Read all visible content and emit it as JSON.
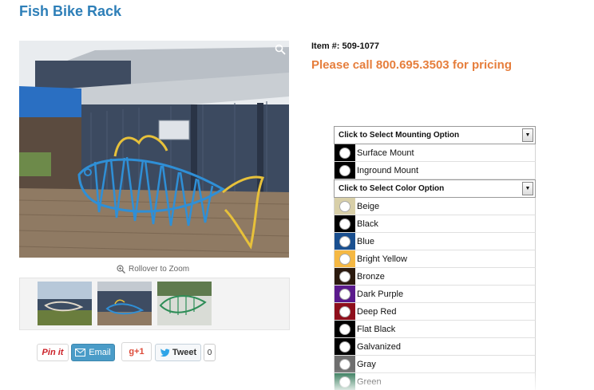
{
  "product": {
    "title": "Fish Bike Rack",
    "item_number": "Item #: 509-1077",
    "pricing_text": "Please call 800.695.3503 for pricing"
  },
  "gallery": {
    "zoom_label": "Rollover to Zoom",
    "zoom_icon": "magnifier-icon",
    "thumbnails": [
      "thumbnail-1",
      "thumbnail-2",
      "thumbnail-3"
    ]
  },
  "share": {
    "pinit_label": "Pin it",
    "email_label": "Email",
    "gplus_label": "g+1",
    "tweet_label": "Tweet",
    "tweet_count": "0"
  },
  "mounting": {
    "select_label": "Click to Select Mounting Option",
    "options": [
      {
        "label": "Surface Mount",
        "color": "#000000"
      },
      {
        "label": "Inground Mount",
        "color": "#000000"
      }
    ]
  },
  "colors": {
    "select_label": "Click to Select Color Option",
    "options": [
      {
        "label": "Beige",
        "color": "#d8cfa8"
      },
      {
        "label": "Black",
        "color": "#000000"
      },
      {
        "label": "Blue",
        "color": "#1a4f8f"
      },
      {
        "label": "Bright Yellow",
        "color": "#f5b843"
      },
      {
        "label": "Bronze",
        "color": "#2b1a0e"
      },
      {
        "label": "Dark Purple",
        "color": "#5a1a8c"
      },
      {
        "label": "Deep Red",
        "color": "#8e0f1c"
      },
      {
        "label": "Flat Black",
        "color": "#000000"
      },
      {
        "label": "Galvanized",
        "color": "#000000"
      },
      {
        "label": "Gray",
        "color": "#6e6e6e"
      },
      {
        "label": "Green",
        "color": "#1d6b47"
      }
    ]
  }
}
